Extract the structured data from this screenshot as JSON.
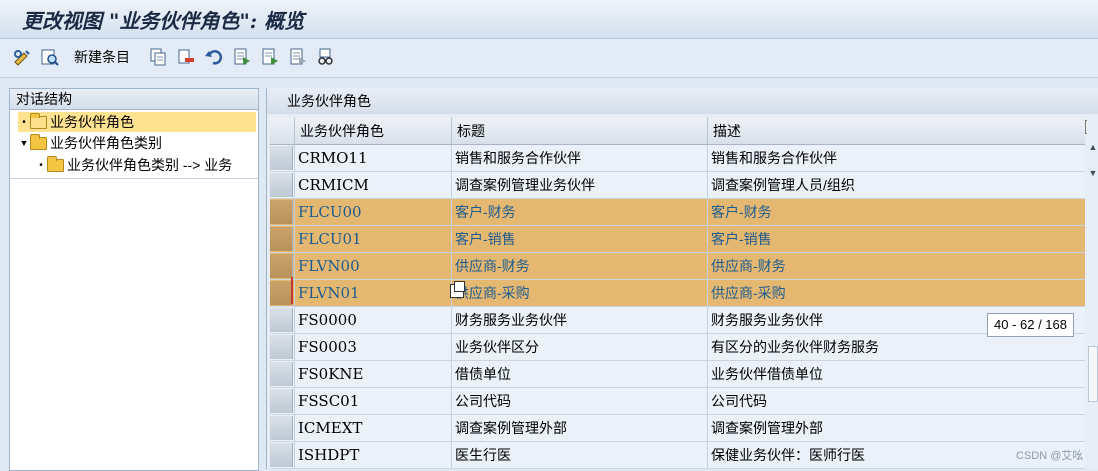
{
  "window": {
    "title": "更改视图 \"业务伙伴角色\": 概览"
  },
  "toolbar": {
    "new_entries_label": "新建条目",
    "icons": [
      "display-change-icon",
      "details-icon",
      "copy-icon",
      "delete-icon",
      "undo-icon",
      "select-all-icon",
      "select-block-icon",
      "deselect-all-icon",
      "print-icon"
    ]
  },
  "tree": {
    "header": "对话结构",
    "nodes": [
      {
        "label": "业务伙伴角色",
        "level": 0,
        "selected": true
      },
      {
        "label": "业务伙伴角色类别",
        "level": 0,
        "expanded": true
      },
      {
        "label": "业务伙伴角色类别 --> 业务",
        "level": 1
      }
    ]
  },
  "table": {
    "panel_title": "业务伙伴角色",
    "columns": [
      "业务伙伴角色",
      "标题",
      "描述"
    ],
    "rows": [
      {
        "role": "CRMO11",
        "title": "销售和服务合作伙伴",
        "desc": "销售和服务合作伙伴",
        "highlight": false
      },
      {
        "role": "CRMICM",
        "title": "调查案例管理业务伙伴",
        "desc": "调查案例管理人员/组织",
        "highlight": false
      },
      {
        "role": "FLCU00",
        "title": "客户-财务",
        "desc": "客户-财务",
        "highlight": true
      },
      {
        "role": "FLCU01",
        "title": "客户-销售",
        "desc": "客户-销售",
        "highlight": true
      },
      {
        "role": "FLVN00",
        "title": "供应商-财务",
        "desc": "供应商-财务",
        "highlight": true
      },
      {
        "role": "FLVN01",
        "title": "供应商-采购",
        "desc": "供应商-采购",
        "highlight": true
      },
      {
        "role": "FS0000",
        "title": "财务服务业务伙伴",
        "desc": "财务服务业务伙伴",
        "highlight": false
      },
      {
        "role": "FS0003",
        "title": "业务伙伴区分",
        "desc": "有区分的业务伙伴财务服务",
        "highlight": false
      },
      {
        "role": "FS0KNE",
        "title": "借债单位",
        "desc": "业务伙伴借债单位",
        "highlight": false
      },
      {
        "role": "FSSC01",
        "title": "公司代码",
        "desc": "公司代码",
        "highlight": false
      },
      {
        "role": "ICMEXT",
        "title": "调查案例管理外部",
        "desc": "调查案例管理外部",
        "highlight": false
      },
      {
        "role": "ISHDPT",
        "title": "医生行医",
        "desc": "保健业务伙伴：医师行医",
        "highlight": false
      }
    ]
  },
  "scroll_indicator": "40 - 62 / 168",
  "watermark": "CSDN @艾吆",
  "colors": {
    "highlight_row": "#e5b872",
    "highlight_text": "#1d5c8f",
    "selected_node": "#ffe28f"
  }
}
